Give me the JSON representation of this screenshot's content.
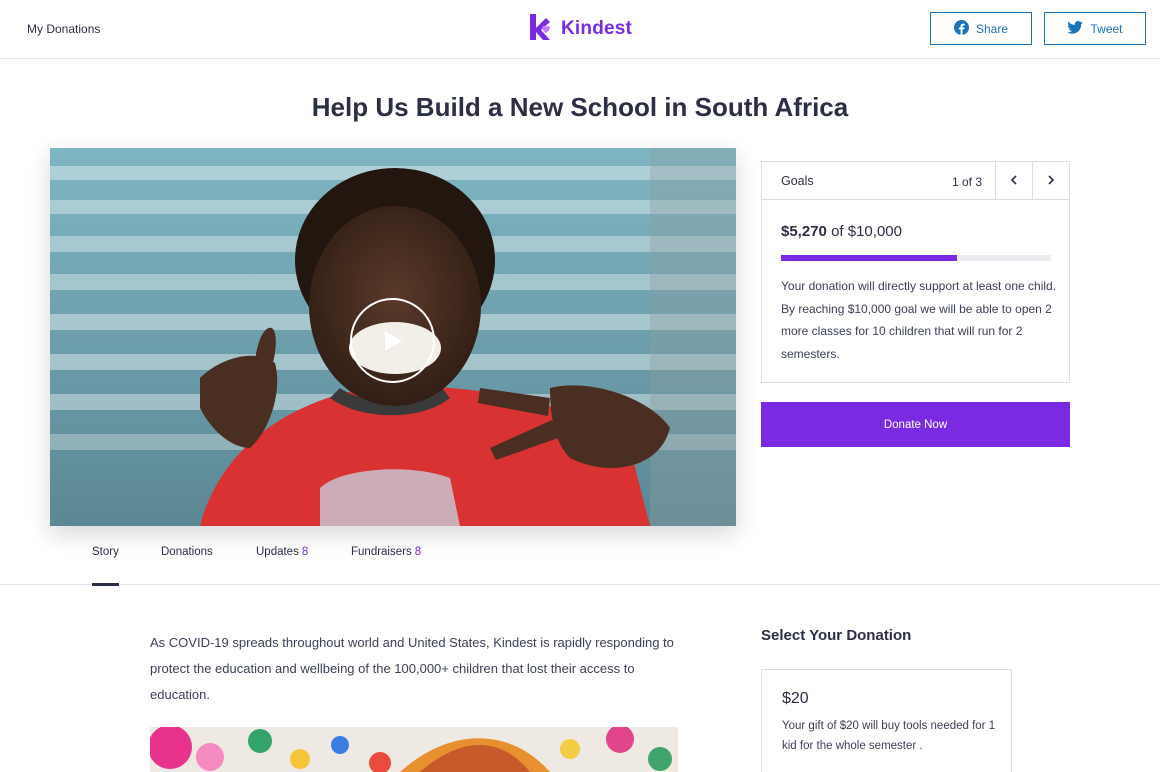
{
  "header": {
    "my_donations": "My Donations",
    "brand_name": "Kindest",
    "share_label": "Share",
    "tweet_label": "Tweet"
  },
  "page": {
    "title": "Help Us Build a New School in South Africa"
  },
  "goals": {
    "title": "Goals",
    "counter": "1 of 3",
    "raised": "$5,270",
    "of_word": "of",
    "target": "$10,000",
    "progress_fraction": 0.65,
    "description": "Your donation will directly support at least one child. By reaching $10,000 goal we will be able to open 2 more classes for 10 children that will run for 2 semesters."
  },
  "donate_button": "Donate Now",
  "tabs": [
    {
      "label": "Story",
      "count": ""
    },
    {
      "label": "Donations",
      "count": ""
    },
    {
      "label": "Updates",
      "count": "8"
    },
    {
      "label": "Fundraisers",
      "count": "8"
    }
  ],
  "story": {
    "paragraph": "As COVID-19 spreads throughout world and United States, Kindest is rapidly responding to protect the education and wellbeing of the 100,000+ children that lost their access to education."
  },
  "donation_select": {
    "title": "Select Your Donation",
    "tiers": [
      {
        "amount": "$20",
        "description": "Your gift of $20 will buy tools needed for 1 kid for the whole semester ."
      }
    ]
  },
  "colors": {
    "accent": "#7a2be2",
    "text": "#2b2f45",
    "social": "#1b73b8"
  },
  "icons": [
    "kindest-logo-icon",
    "facebook-icon",
    "twitter-icon",
    "play-icon",
    "chevron-left-icon",
    "chevron-right-icon"
  ]
}
